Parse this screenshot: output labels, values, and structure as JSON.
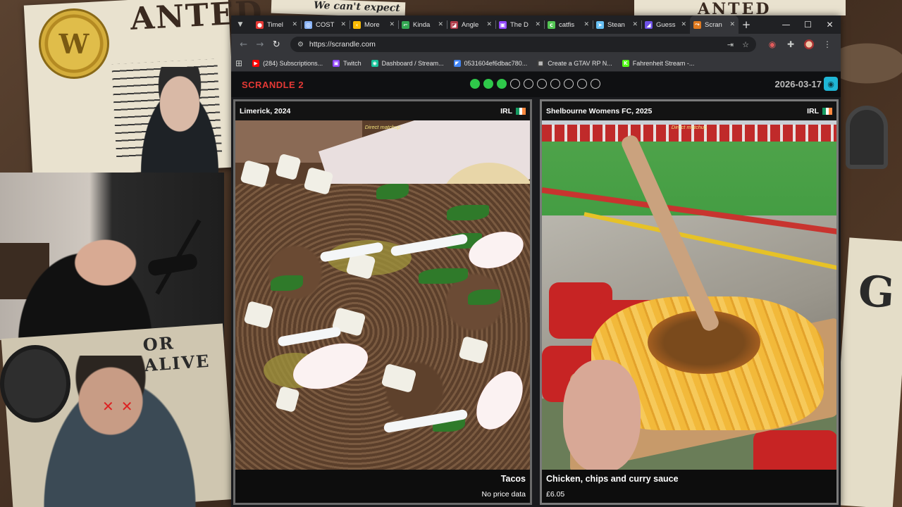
{
  "background": {
    "poster_top_left": "ANTED",
    "poster_top_center": "We can't expect",
    "poster_top_right": "ANTED",
    "poster_bottom_left": "OR ALIVE",
    "poster_bottom_right": "G"
  },
  "browser": {
    "tabs": [
      {
        "label": "Timel",
        "icon": "record-icon",
        "color": "#e53935",
        "glyph": "●"
      },
      {
        "label": "COST",
        "icon": "globe-icon",
        "color": "#8ab4f8",
        "glyph": "◎"
      },
      {
        "label": "More",
        "icon": "chevron-icon",
        "color": "#fbbc04",
        "glyph": "‹"
      },
      {
        "label": "Kinda",
        "icon": "stream-icon",
        "color": "#34a853",
        "glyph": "⌐"
      },
      {
        "label": "Angle",
        "icon": "angle-icon",
        "color": "#b03a48",
        "glyph": "◪"
      },
      {
        "label": "The D",
        "icon": "twitch-icon",
        "color": "#9146ff",
        "glyph": "▣"
      },
      {
        "label": "catfis",
        "icon": "catfish-icon",
        "color": "#53c653",
        "glyph": "c"
      },
      {
        "label": "Stean",
        "icon": "steam-icon",
        "color": "#66c0f4",
        "glyph": "➤"
      },
      {
        "label": "Guess",
        "icon": "guess-icon",
        "color": "#6f52e8",
        "glyph": "◢"
      },
      {
        "label": "Scran",
        "icon": "scrandle-icon",
        "color": "#e07a1f",
        "glyph": "⤳",
        "active": true
      }
    ],
    "url": "https://scrandle.com",
    "bookmarks": [
      {
        "label": "(284) Subscriptions...",
        "icon": "youtube-icon",
        "color": "#ff0000",
        "glyph": "▶"
      },
      {
        "label": "Twitch",
        "icon": "twitch-icon",
        "color": "#9146ff",
        "glyph": "▣"
      },
      {
        "label": "Dashboard / Stream...",
        "icon": "streamelements-icon",
        "color": "#15c39a",
        "glyph": "◉"
      },
      {
        "label": "0531604ef6dbac780...",
        "icon": "file-icon",
        "color": "#4285f4",
        "glyph": "◤"
      },
      {
        "label": "Create a GTAV RP N...",
        "icon": "gta-icon",
        "color": "#3c3c3c",
        "glyph": "▦"
      },
      {
        "label": "Fahrenheit Stream -...",
        "icon": "kick-icon",
        "color": "#53fc18",
        "glyph": "K"
      }
    ]
  },
  "scrandle": {
    "brand": "SCRANDLE 2",
    "progress": [
      "done",
      "done",
      "done",
      "empty",
      "empty",
      "empty",
      "empty",
      "empty",
      "empty",
      "empty"
    ],
    "date": "2026-03-17",
    "accent": "#e53935",
    "progress_color": "#2fc84a",
    "cards": [
      {
        "place": "Limerick, 2024",
        "country": "IRL",
        "matchup": "Direct matchup",
        "dish": "Tacos",
        "price": "No price data"
      },
      {
        "place": "Shelbourne Womens FC, 2025",
        "country": "IRL",
        "matchup": "Direct matchup",
        "dish": "Chicken, chips and curry sauce",
        "price": "£6.05"
      }
    ]
  }
}
